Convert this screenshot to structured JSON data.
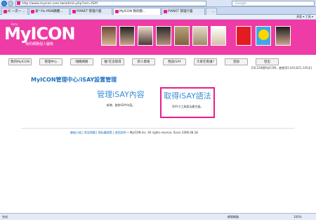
{
  "browser": {
    "url": "http://www.myicon.com.tw/admin.php?act=ISAY",
    "search_placeholder": "Google"
  },
  "tabs": [
    {
      "label": "IE 一次一 ..."
    },
    {
      "label": "會*  Pix MSN顯圖..."
    },
    {
      "label": "PIXNET 管理介面"
    },
    {
      "label": "MyICON 我的圖..."
    },
    {
      "label": "PIXNET 管理介面"
    },
    {
      "label": "..."
    }
  ],
  "toolsbar_text": "頁面 ▾   工具 ▾",
  "banner": {
    "logo": "MyICON",
    "logo_tag": "我的網路個人圖像",
    "logo_small": "Beta"
  },
  "avatars": [
    "avatar-1",
    "avatar-2",
    "avatar-3",
    "avatar-4",
    "avatar-5",
    "avatar-6",
    "avatar-7",
    "avatar-8",
    "avatar-9",
    "avatar-10"
  ],
  "nav": [
    "我的MyICON",
    "管理中心",
    "隨機網路",
    "推!在這取得",
    "新人資格",
    "我說iSAY",
    "大家在看誰?",
    "登錄",
    "登出"
  ],
  "stats": "[50,528個MyICON，被使用1,043,821,145次]",
  "page_title": "MyICON管理中心/iSAY設置管理",
  "card1": {
    "title": "管理iSAY內容",
    "desc": "新增、刪除iSAY內容。"
  },
  "card2": {
    "title": "取得iSAY語法",
    "desc": "iSAY小工具語法產生器。"
  },
  "footer": {
    "link1": "聯絡小組",
    "sep1": " | ",
    "link2": "常見問題",
    "sep2": " | ",
    "link3": "隱私權政策",
    "sep3": " | ",
    "link4": "使用說明",
    "copyright": " • MyICON Inc. All rights reserve. Since 2006.08.18"
  },
  "statusbar": {
    "left": "完成",
    "zone": "網際網路",
    "zoom": "100%"
  }
}
